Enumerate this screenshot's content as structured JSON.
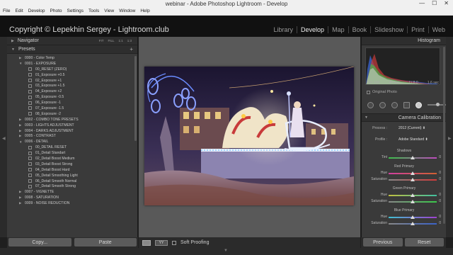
{
  "window": {
    "title": "webinar - Adobe Photoshop Lightroom - Develop",
    "min": "—",
    "max": "☐",
    "close": "✕"
  },
  "menu": [
    "File",
    "Edit",
    "Develop",
    "Photo",
    "Settings",
    "Tools",
    "View",
    "Window",
    "Help"
  ],
  "identity": {
    "copyright": "Copyright © Lepekhin Sergey - Lightroom.club"
  },
  "modules": [
    {
      "label": "Library",
      "active": false
    },
    {
      "label": "Develop",
      "active": true
    },
    {
      "label": "Map",
      "active": false
    },
    {
      "label": "Book",
      "active": false
    },
    {
      "label": "Slideshow",
      "active": false
    },
    {
      "label": "Print",
      "active": false
    },
    {
      "label": "Web",
      "active": false
    }
  ],
  "left": {
    "navigator": {
      "title": "Navigator",
      "options": [
        "FIT",
        "FILL",
        "1:1",
        "1:3"
      ]
    },
    "presets": {
      "title": "Presets",
      "plus": "+",
      "items": [
        {
          "kind": "folder",
          "open": false,
          "label": "0000 - Color Temp"
        },
        {
          "kind": "folder",
          "open": true,
          "label": "0001 - EXPOSURE"
        },
        {
          "kind": "preset",
          "label": "00_RESET (ZERO)"
        },
        {
          "kind": "preset",
          "label": "01_Exposure +0.5"
        },
        {
          "kind": "preset",
          "label": "02_Exposure +1"
        },
        {
          "kind": "preset",
          "label": "03_Exposure +1.5"
        },
        {
          "kind": "preset",
          "label": "04_Exposure +2"
        },
        {
          "kind": "preset",
          "label": "05_Exposure -0.5"
        },
        {
          "kind": "preset",
          "label": "06_Exposure -1"
        },
        {
          "kind": "preset",
          "label": "07_Exposure -1.5"
        },
        {
          "kind": "preset",
          "label": "08_Exposure -2"
        },
        {
          "kind": "folder",
          "open": false,
          "label": "0002 - COMBO TONE PRESETS"
        },
        {
          "kind": "folder",
          "open": false,
          "label": "0003 - LIGHTS ADJUSTMENT"
        },
        {
          "kind": "folder",
          "open": false,
          "label": "0004 - DARKS ADJUSTMENT"
        },
        {
          "kind": "folder",
          "open": false,
          "label": "0005 - CONTRAST"
        },
        {
          "kind": "folder",
          "open": true,
          "label": "0006 - DETAIL"
        },
        {
          "kind": "preset",
          "label": "00_DETAIL RESET"
        },
        {
          "kind": "preset",
          "label": "01_Detail Standart"
        },
        {
          "kind": "preset",
          "label": "02_Detail Boost Medium"
        },
        {
          "kind": "preset",
          "label": "03_Detail Boost Strong"
        },
        {
          "kind": "preset",
          "label": "04_Detail Boost Hard"
        },
        {
          "kind": "preset",
          "label": "05_Detail Smoothing Light"
        },
        {
          "kind": "preset",
          "label": "06_Detail Smooth Normal"
        },
        {
          "kind": "preset",
          "label": "07_Detail Smooth Strong"
        },
        {
          "kind": "folder",
          "open": false,
          "label": "0007 - VIGNETTE"
        },
        {
          "kind": "folder",
          "open": false,
          "label": "0008 - SATURATION"
        },
        {
          "kind": "folder",
          "open": false,
          "label": "0009 - NOISE REDUCTION"
        }
      ]
    },
    "buttons": {
      "copy": "Copy...",
      "paste": "Paste"
    }
  },
  "toolbar": {
    "view_label": "YY",
    "soft_proofing": "Soft Proofing"
  },
  "right": {
    "histogram": {
      "title": "Histogram",
      "iso": "ISO 100",
      "focal": "40 mm",
      "aperture": "f / 8.0",
      "shutter": "1.6 sec",
      "original_photo": "Original Photo"
    },
    "calibration": {
      "title": "Camera Calibration",
      "process_label": "Process :",
      "process_value": "2012 (Current) ⬍",
      "profile_label": "Profile :",
      "profile_value": "Adobe Standard ⬍",
      "sections": [
        {
          "title": "Shadows",
          "sliders": [
            {
              "label": "Tint",
              "value": "0",
              "pos": 0.5,
              "gradient": "green-magenta"
            }
          ]
        },
        {
          "title": "Red Primary",
          "sliders": [
            {
              "label": "Hue",
              "value": "0",
              "pos": 0.5,
              "gradient": "red-hue"
            },
            {
              "label": "Saturation",
              "value": "0",
              "pos": 0.5,
              "gradient": "red-sat"
            }
          ]
        },
        {
          "title": "Green Primary",
          "sliders": [
            {
              "label": "Hue",
              "value": "0",
              "pos": 0.5,
              "gradient": "green-hue"
            },
            {
              "label": "Saturation",
              "value": "0",
              "pos": 0.5,
              "gradient": "green-sat"
            }
          ]
        },
        {
          "title": "Blue Primary",
          "sliders": [
            {
              "label": "Hue",
              "value": "0",
              "pos": 0.5,
              "gradient": "blue-hue"
            },
            {
              "label": "Saturation",
              "value": "0",
              "pos": 0.5,
              "gradient": "blue-sat"
            }
          ]
        }
      ]
    },
    "buttons": {
      "previous": "Previous",
      "reset": "Reset"
    }
  },
  "colors": {
    "active_module": "#ececec",
    "panel_bg": "#3a3a3a",
    "center_bg": "#595959"
  }
}
